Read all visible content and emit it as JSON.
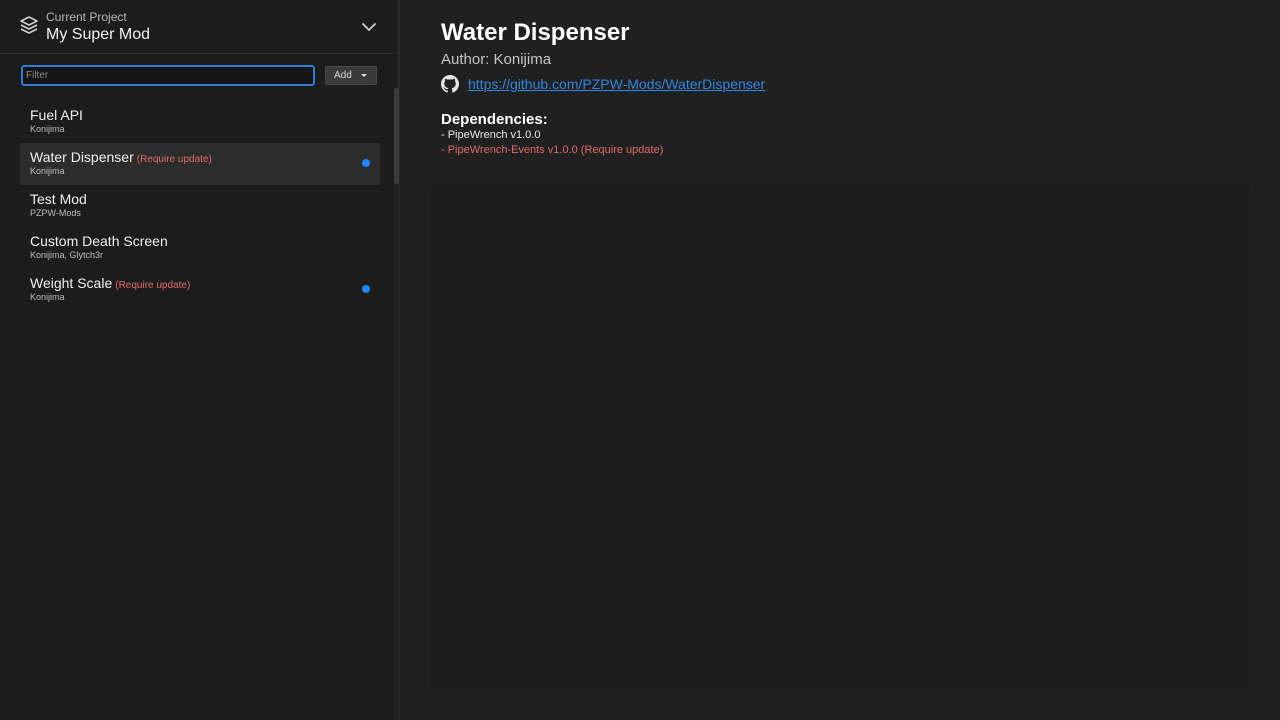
{
  "sidebar": {
    "project": {
      "caption": "Current Project",
      "name": "My Super Mod",
      "icon": "layers-icon",
      "expand_icon": "chevron-down-icon"
    },
    "filter": {
      "placeholder": "Filter",
      "value": ""
    },
    "add_label": "Add",
    "mods": [
      {
        "title": "Fuel API",
        "warning": "",
        "author": "Konijima",
        "selected": false,
        "dot": false
      },
      {
        "title": "Water Dispenser",
        "warning": "(Require update)",
        "author": "Konijima",
        "selected": true,
        "dot": true
      },
      {
        "title": "Test Mod",
        "warning": "",
        "author": "PZPW-Mods",
        "selected": false,
        "dot": false
      },
      {
        "title": "Custom Death Screen",
        "warning": "",
        "author": "Konijima, Glytch3r",
        "selected": false,
        "dot": false
      },
      {
        "title": "Weight Scale",
        "warning": "(Require update)",
        "author": "Konijima",
        "selected": false,
        "dot": true
      }
    ]
  },
  "detail": {
    "title": "Water Dispenser",
    "author_line": "Author: Konijima",
    "repo_url": "https://github.com/PZPW-Mods/WaterDispenser",
    "repo_icon": "github-icon",
    "dependencies_title": "Dependencies:",
    "dependencies": [
      {
        "text": "- PipeWrench v1.0.0",
        "needs_update": false
      },
      {
        "text": "- PipeWrench-Events v1.0.0 (Require update)",
        "needs_update": true
      }
    ]
  },
  "colors": {
    "accent": "#2f86e4",
    "warning": "#e06c6c",
    "dot": "#1f86ff"
  }
}
